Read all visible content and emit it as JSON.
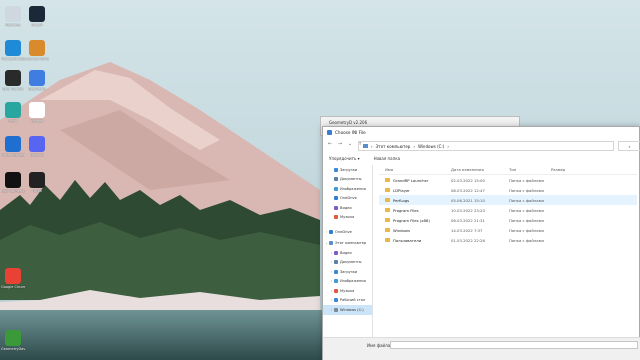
{
  "desktop": {
    "icons": [
      {
        "label": "Корзина",
        "color": "#cfd8e0",
        "icon": "recycle-bin-icon"
      },
      {
        "label": "Steam",
        "color": "#1b2838",
        "icon": "steam-icon"
      },
      {
        "label": "Microsoft Edge",
        "color": "#1f8bd6",
        "icon": "edge-icon"
      },
      {
        "label": "Counter-Strike",
        "color": "#d98a2b",
        "icon": "cs-icon"
      },
      {
        "label": "Epic Games",
        "color": "#2a2a2a",
        "icon": "epic-icon"
      },
      {
        "label": "Geometry",
        "color": "#3f7de0",
        "icon": "app-icon"
      },
      {
        "label": "Paint",
        "color": "#2aa6a1",
        "icon": "paint-icon"
      },
      {
        "label": "Yandex",
        "color": "#ffffff",
        "icon": "yandex-icon"
      },
      {
        "label": "Malwarebytes",
        "color": "#1f6fd1",
        "icon": "malwarebytes-icon"
      },
      {
        "label": "Discord",
        "color": "#5865f2",
        "icon": "discord-icon"
      },
      {
        "label": "Epic Games Launcher",
        "color": "#111111",
        "icon": "epic-launcher-icon"
      },
      {
        "label": "Forza",
        "color": "#222222",
        "icon": "forza-icon"
      },
      {
        "label": "Google Chrome",
        "color": "#e94235",
        "icon": "chrome-icon"
      },
      {
        "label": "GeometryDash",
        "color": "#3a9a3a",
        "icon": "geometry-dash-icon"
      }
    ]
  },
  "background_window": {
    "title": "GeometryD v2.206"
  },
  "dialog": {
    "title": "Choose INI File",
    "address": {
      "segments": [
        "Этот компьютер",
        "Windows (C:)"
      ]
    },
    "command_bar": {
      "organize": "Упорядочить ▾",
      "new_folder": "Новая папка"
    },
    "nav_pane": [
      {
        "label": "Загрузки",
        "color": "#3a88d6",
        "indent": 1,
        "chev": ""
      },
      {
        "label": "Документы",
        "color": "#5a7fa8",
        "indent": 1,
        "chev": ""
      },
      {
        "label": "Изображения",
        "color": "#3f9ad9",
        "indent": 1,
        "chev": ""
      },
      {
        "label": "OneDrive",
        "color": "#2f7fd1",
        "indent": 1,
        "chev": ""
      },
      {
        "label": "Видео",
        "color": "#7b5cc9",
        "indent": 1,
        "chev": ""
      },
      {
        "label": "Музыка",
        "color": "#e2563c",
        "indent": 1,
        "chev": ""
      },
      {
        "label": "OneDrive",
        "color": "#2f7fd1",
        "indent": 0,
        "chev": "›"
      },
      {
        "label": "Этот компьютер",
        "color": "#5a8ec9",
        "indent": 0,
        "chev": "⌄"
      },
      {
        "label": "Видео",
        "color": "#7b5cc9",
        "indent": 1,
        "chev": "›"
      },
      {
        "label": "Документы",
        "color": "#5a7fa8",
        "indent": 1,
        "chev": "›"
      },
      {
        "label": "Загрузки",
        "color": "#3a88d6",
        "indent": 1,
        "chev": "›"
      },
      {
        "label": "Изображения",
        "color": "#3f9ad9",
        "indent": 1,
        "chev": "›"
      },
      {
        "label": "Музыка",
        "color": "#e2563c",
        "indent": 1,
        "chev": "›"
      },
      {
        "label": "Рабочий стол",
        "color": "#3a88d6",
        "indent": 1,
        "chev": "›"
      },
      {
        "label": "Windows (C:)",
        "color": "#7a8a9a",
        "indent": 1,
        "chev": "›",
        "selected": true
      }
    ],
    "list": {
      "headers": {
        "name": "Имя",
        "date": "Дата изменения",
        "type": "Тип",
        "size": "Размер"
      },
      "rows": [
        {
          "name": "GrandRP Launcher",
          "date": "02.03.2022 15:00",
          "type": "Папка с файлами",
          "hover": false
        },
        {
          "name": "LDPlayer",
          "date": "08.03.2022 12:47",
          "type": "Папка с файлами",
          "hover": false
        },
        {
          "name": "PerfLogs",
          "date": "05.06.2021 15:10",
          "type": "Папка с файлами",
          "hover": true
        },
        {
          "name": "Program Files",
          "date": "10.03.2022 23:20",
          "type": "Папка с файлами",
          "hover": false
        },
        {
          "name": "Program Files (x86)",
          "date": "06.03.2022 21:31",
          "type": "Папка с файлами",
          "hover": false
        },
        {
          "name": "Windows",
          "date": "14.03.2022 7:37",
          "type": "Папка с файлами",
          "hover": false
        },
        {
          "name": "Пользователи",
          "date": "01.03.2022 22:26",
          "type": "Папка с файлами",
          "hover": false
        }
      ]
    },
    "file_name_label": "Имя файла:"
  }
}
